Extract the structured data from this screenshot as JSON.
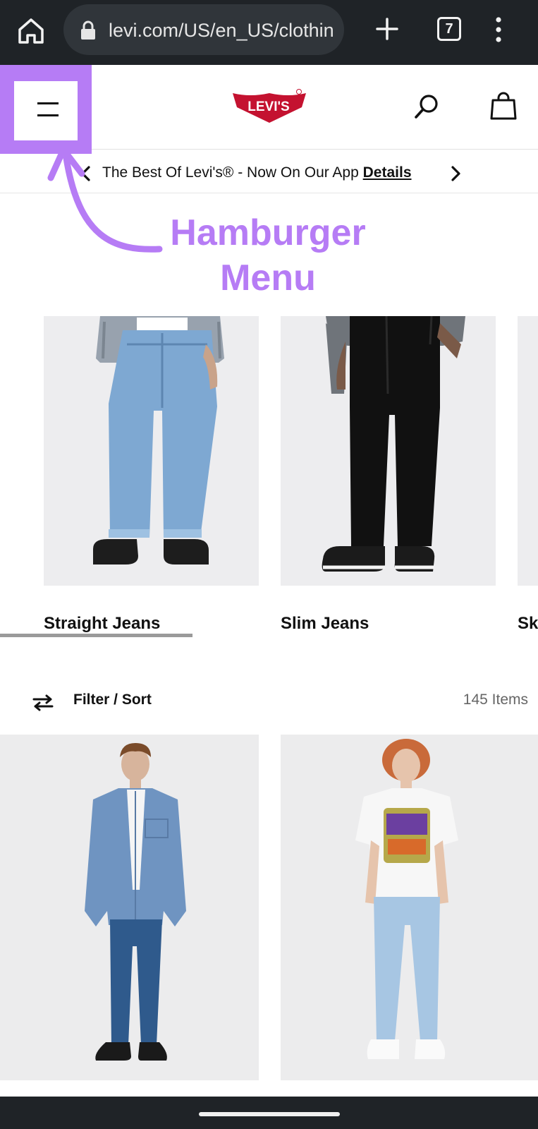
{
  "browser": {
    "url": "levi.com/US/en_US/clothing",
    "tab_count": "7"
  },
  "header": {
    "brand": "Levi's",
    "brand_color": "#c41230"
  },
  "promo": {
    "message": "The Best Of Levi's® - Now On Our App",
    "link_label": "Details"
  },
  "annotation": {
    "line1": "Hamburger",
    "line2": "Menu",
    "color": "#b67cf5"
  },
  "categories": [
    {
      "label": "Straight Jeans"
    },
    {
      "label": "Slim Jeans"
    },
    {
      "label": "Sk"
    }
  ],
  "listing": {
    "filter_label": "Filter / Sort",
    "items_count": "145 Items"
  }
}
